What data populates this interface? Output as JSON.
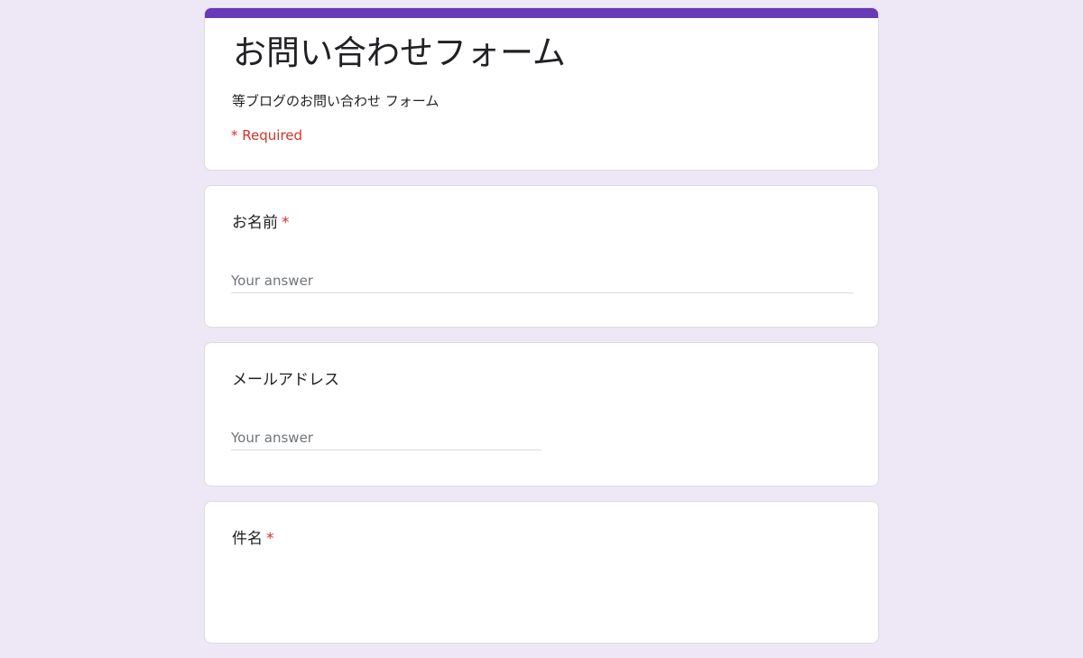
{
  "form": {
    "title": "お問い合わせフォーム",
    "description": "等ブログのお問い合わせ フォーム",
    "required_note": "* Required",
    "accent_color": "#673ab7",
    "background_color": "#ede7f6",
    "required_color": "#d93025"
  },
  "questions": [
    {
      "label": "お名前",
      "required_marker": "*",
      "placeholder": "Your answer"
    },
    {
      "label": "メールアドレス",
      "required_marker": "",
      "placeholder": "Your answer"
    },
    {
      "label": "件名",
      "required_marker": "*"
    }
  ]
}
